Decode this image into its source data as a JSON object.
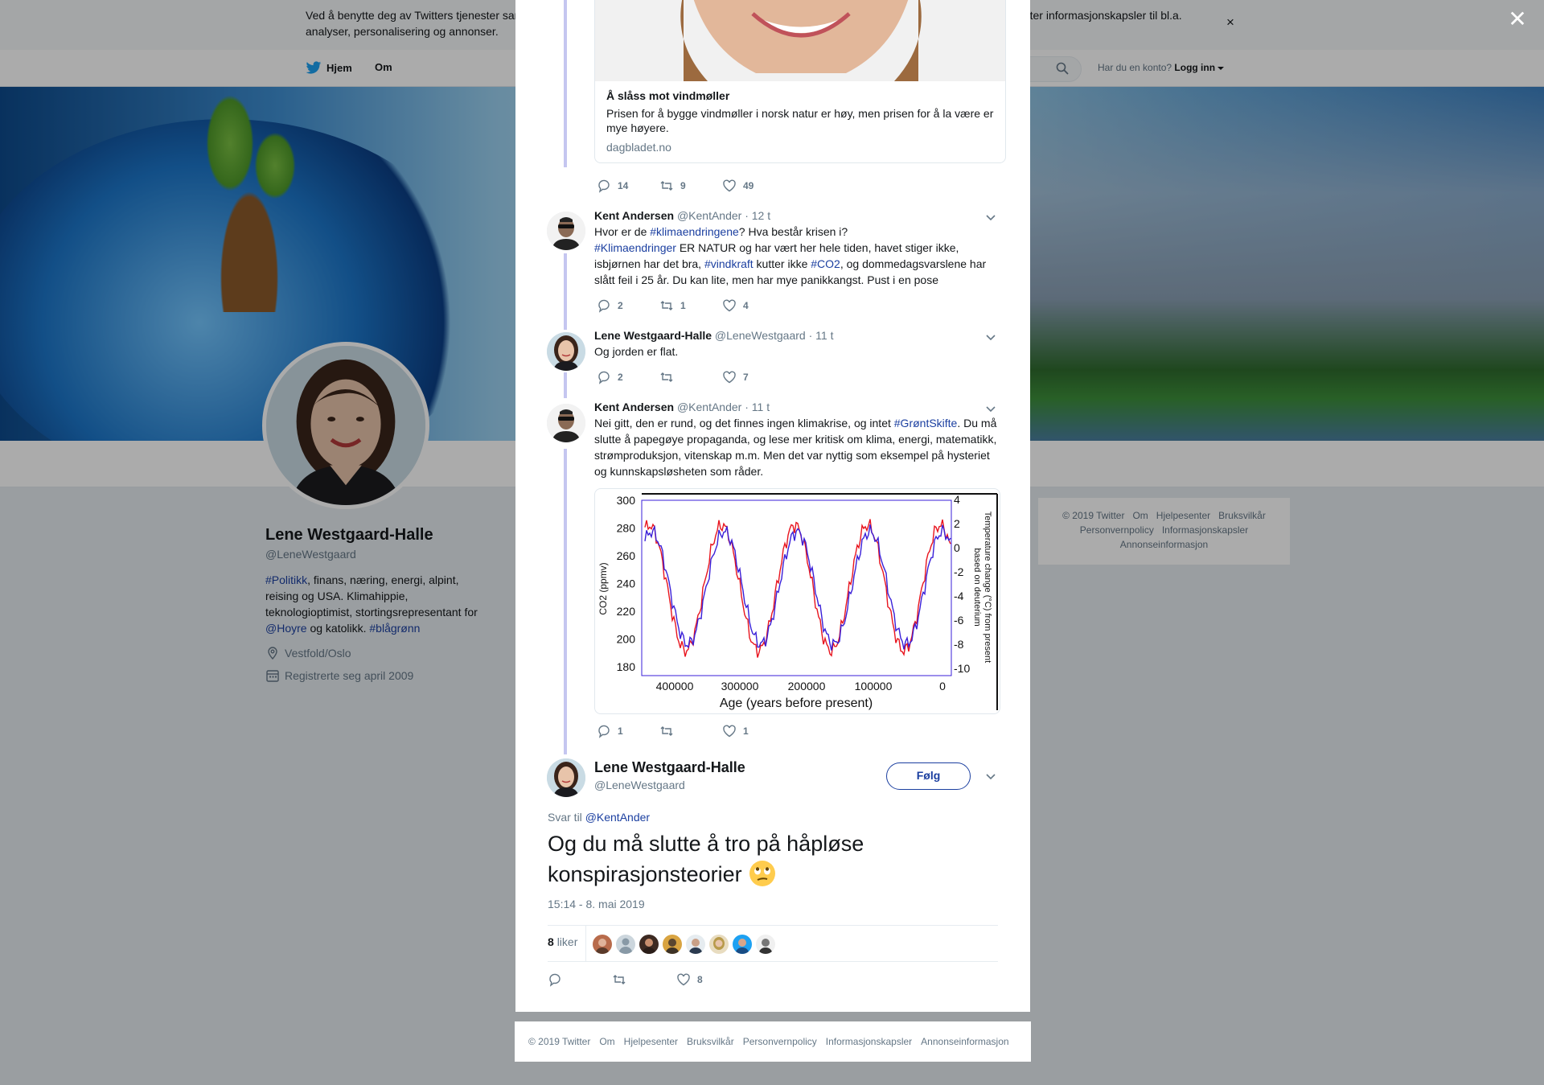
{
  "cookie": {
    "text": "Ved å benytte deg av Twitters tjenester samtykker du til vår bruk av informasjonskapsler og dataoverføring utenfor EU. Vi og partnerne våre benytter informasjonskapsler til bl.a. analyser, personalisering og annonser."
  },
  "nav": {
    "home": "Hjem",
    "about": "Om",
    "have_account": "Har du en konto?",
    "login": "Logg inn"
  },
  "profile": {
    "name": "Lene Westgaard-Halle",
    "handle": "@LeneWestgaard",
    "bio_parts": {
      "p1": "#Politikk",
      "p2": ", finans, næring, energi, alpint, reising og USA. Klimahippie, teknologioptimist, stortingsrepresentant for ",
      "p3": "@Hoyre",
      "p4": " og katolikk. ",
      "p5": "#blågrønn"
    },
    "location": "Vestfold/Oslo",
    "joined": "Registrerte seg april 2009"
  },
  "side_footer": {
    "links": [
      "© 2019 Twitter",
      "Om",
      "Hjelpesenter",
      "Bruksvilkår",
      "Personvernpolicy",
      "Informasjonskapsler",
      "Annonseinformasjon"
    ]
  },
  "card": {
    "title": "Å slåss mot vindmøller",
    "description": "Prisen for å bygge vindmøller i norsk natur er høy, men prisen for å la være er mye høyere.",
    "domain": "dagbladet.no"
  },
  "card_actions": {
    "replies": "14",
    "retweets": "9",
    "likes": "49"
  },
  "tweets": [
    {
      "name": "Kent Andersen",
      "handle": "@KentAnder",
      "time": "· 12 t",
      "text": {
        "a": "Hvor er de ",
        "b": "#klimaendringene",
        "c": "? Hva består krisen i?",
        "d": "#Klimaendringer",
        "e": " ER NATUR og har vært her hele tiden, havet stiger ikke, isbjørnen har det bra, ",
        "f": "#vindkraft",
        "g": " kutter ikke ",
        "h": "#CO2",
        "i": ", og dommedagsvarslene har slått feil i 25 år. Du kan lite, men har mye panikkangst. Pust i en pose"
      },
      "replies": "2",
      "retweets": "1",
      "likes": "4"
    },
    {
      "name": "Lene Westgaard-Halle",
      "handle": "@LeneWestgaard",
      "time": "· 11 t",
      "text": "Og jorden er flat.",
      "replies": "2",
      "retweets": "",
      "likes": "7"
    },
    {
      "name": "Kent Andersen",
      "handle": "@KentAnder",
      "time": "· 11 t",
      "text": {
        "a": "Nei gitt, den er rund, og det finnes ingen klimakrise, og intet ",
        "b": "#GrøntSkifte",
        "c": ". Du må slutte å papegøye propaganda, og lese mer kritisk om klima, energi, matematikk, strømproduksjon, vitenskap m.m. Men det var nyttig som eksempel på hysteriet og kunnskapsløsheten som råder."
      },
      "replies": "1",
      "retweets": "",
      "likes": "1"
    }
  ],
  "embedded_chart": {
    "xlabel": "Age (years before present)",
    "ylabel_left": "CO2 (ppmv)",
    "ylabel_right": "Temperature change (°C) from present based on deuterium",
    "x_ticks": [
      "400000",
      "300000",
      "200000",
      "100000",
      "0"
    ],
    "y_left_ticks": [
      "300",
      "280",
      "260",
      "240",
      "220",
      "200",
      "180"
    ],
    "y_right_ticks": [
      "4",
      "2",
      "0",
      "-2",
      "-4",
      "-6",
      "-8",
      "-10"
    ],
    "colors": {
      "co2": "#3a1fd8",
      "temp": "#e8141e"
    }
  },
  "main_tweet": {
    "name": "Lene Westgaard-Halle",
    "handle": "@LeneWestgaard",
    "follow": "Følg",
    "reply_prefix": "Svar til",
    "reply_handle": "@KentAnder",
    "text": "Og du må slutte å tro på håpløse konspirasjonsteorier",
    "emoji": "face-with-rolling-eyes",
    "timestamp": "15:14 - 8. mai 2019",
    "likes_count": "8",
    "likes_label": "liker",
    "action_likes": "8"
  },
  "modal_footer": {
    "links": [
      "© 2019 Twitter",
      "Om",
      "Hjelpesenter",
      "Bruksvilkår",
      "Personvernpolicy",
      "Informasjonskapsler",
      "Annonseinformasjon"
    ]
  }
}
